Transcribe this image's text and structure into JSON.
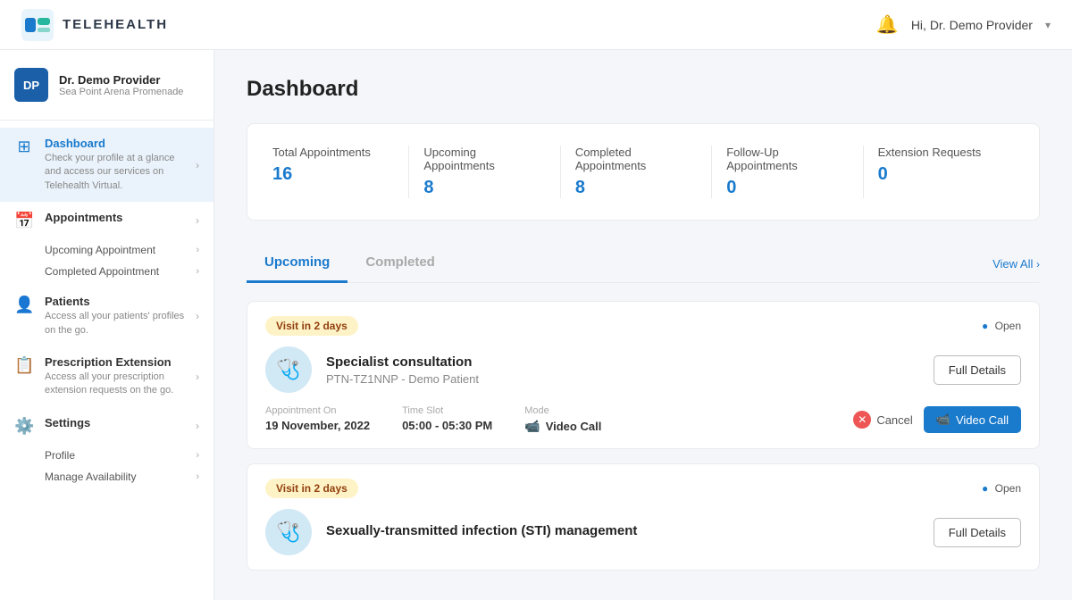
{
  "app": {
    "name": "TELEHEALTH",
    "user_greeting": "Hi, Dr. Demo Provider"
  },
  "sidebar": {
    "profile": {
      "initials": "DP",
      "name": "Dr. Demo Provider",
      "location": "Sea Point Arena Promenade"
    },
    "items": [
      {
        "id": "dashboard",
        "label": "Dashboard",
        "desc": "Check your profile at a glance and access our services on Telehealth Virtual.",
        "active": true,
        "icon": "⊞"
      },
      {
        "id": "appointments",
        "label": "Appointments",
        "desc": "",
        "active": false,
        "icon": "📅",
        "subitems": [
          "Upcoming Appointment",
          "Completed Appointment"
        ]
      },
      {
        "id": "patients",
        "label": "Patients",
        "desc": "Access all your patients' profiles on the go.",
        "active": false,
        "icon": "👤"
      },
      {
        "id": "prescription",
        "label": "Prescription Extension",
        "desc": "Access all your prescription extension requests on the go.",
        "active": false,
        "icon": "📋"
      },
      {
        "id": "settings",
        "label": "Settings",
        "desc": "",
        "active": false,
        "icon": "⚙️",
        "subitems": [
          "Profile",
          "Manage Availability"
        ]
      }
    ]
  },
  "main": {
    "page_title": "Dashboard",
    "stats": [
      {
        "label": "Total Appointments",
        "value": "16"
      },
      {
        "label": "Upcoming Appointments",
        "value": "8"
      },
      {
        "label": "Completed Appointments",
        "value": "8"
      },
      {
        "label": "Follow-Up Appointments",
        "value": "0"
      },
      {
        "label": "Extension Requests",
        "value": "0"
      }
    ],
    "tabs": [
      "Upcoming",
      "Completed"
    ],
    "active_tab": "Upcoming",
    "view_all": "View All",
    "appointments": [
      {
        "id": 1,
        "badge": "Visit in 2 days",
        "status": "Open",
        "title": "Specialist consultation",
        "patient": "PTN-TZ1NNP - Demo Patient",
        "date_label": "Appointment On",
        "date": "19 November, 2022",
        "time_label": "Time Slot",
        "time": "05:00 - 05:30 PM",
        "mode_label": "Mode",
        "mode": "Video Call",
        "icon": "🩺"
      },
      {
        "id": 2,
        "badge": "Visit in 2 days",
        "status": "Open",
        "title": "Sexually-transmitted infection (STI) management",
        "patient": "",
        "date_label": "",
        "date": "",
        "time_label": "",
        "time": "",
        "mode_label": "",
        "mode": "",
        "icon": "🩺"
      }
    ],
    "buttons": {
      "full_details": "Full Details",
      "cancel": "Cancel",
      "video_call": "Video Call"
    }
  }
}
